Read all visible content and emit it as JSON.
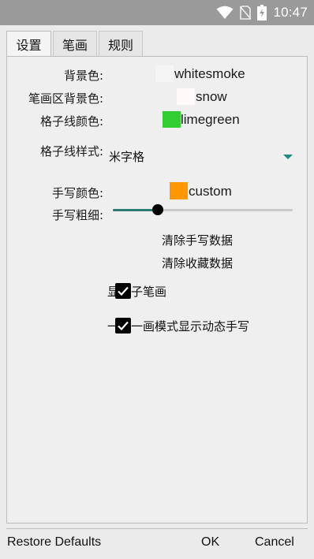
{
  "status_bar": {
    "time": "10:47",
    "icons": [
      "wifi-icon",
      "no-sim-icon",
      "battery-charging-icon"
    ]
  },
  "tabs": [
    {
      "label": "设置",
      "active": true
    },
    {
      "label": "笔画",
      "active": false
    },
    {
      "label": "规则",
      "active": false
    }
  ],
  "settings": {
    "background_color": {
      "label": "背景色:",
      "value": "whitesmoke",
      "swatch": "#f5f5f5"
    },
    "stroke_area_background": {
      "label": "笔画区背景色:",
      "value": "snow",
      "swatch": "#fffafa"
    },
    "grid_line_color": {
      "label": "格子线颜色:",
      "value": "limegreen",
      "swatch": "#32cd32"
    },
    "grid_line_style": {
      "label": "格子线样式:",
      "value": "米字格"
    },
    "handwriting_color": {
      "label": "手写颜色:",
      "value": "custom",
      "swatch": "#ff9800"
    },
    "handwriting_thickness": {
      "label": "手写粗细:",
      "level": 0.25
    }
  },
  "actions": {
    "clear_handwriting": "清除手写数据",
    "clear_favorites": "清除收藏数据"
  },
  "checkboxes": [
    {
      "label": "显示子笔画",
      "checked": true
    },
    {
      "label": "一笔一画模式显示动态手写",
      "checked": true
    }
  ],
  "footer": {
    "restore_defaults": "Restore Defaults",
    "ok": "OK",
    "cancel": "Cancel"
  }
}
